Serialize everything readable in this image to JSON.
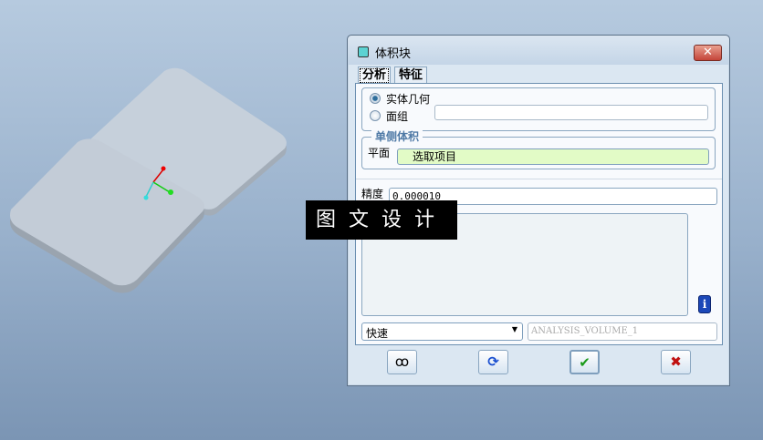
{
  "dialog": {
    "title": "体积块",
    "close_label": "✕"
  },
  "tabs": [
    {
      "label": "分析"
    },
    {
      "label": "特征"
    }
  ],
  "geometry": {
    "option_solid": "实体几何",
    "option_quilt": "面组",
    "quilt_value": ""
  },
  "one_side": {
    "title": "单侧体积",
    "plane_label": "平面",
    "plane_value": "选取项目"
  },
  "precision": {
    "label": "精度",
    "value": "0.000010"
  },
  "results_text": "",
  "mode": {
    "selected": "快速"
  },
  "analysis_name": "ANALYSIS_VOLUME_1",
  "buttons": {
    "preview": "ꝏ",
    "repeat": "⟳",
    "ok": "✔",
    "cancel": "✖"
  },
  "watermark": "图文设计",
  "colors": {
    "plane_field": "#e2fbc6",
    "group_title": "#4f7aa6",
    "ok": "#1a9a1a",
    "cancel": "#c01010"
  }
}
